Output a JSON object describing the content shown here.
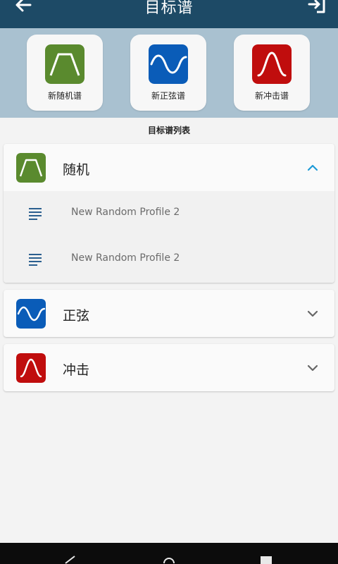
{
  "header": {
    "title": "目标谱",
    "back_icon": "arrow-left-icon",
    "exit_icon": "exit-icon"
  },
  "quick_actions": [
    {
      "label": "新随机谱",
      "icon": "random-profile-icon",
      "color": "#5a8a2e"
    },
    {
      "label": "新正弦谱",
      "icon": "sine-profile-icon",
      "color": "#0a5cb8"
    },
    {
      "label": "新冲击谱",
      "icon": "shock-profile-icon",
      "color": "#c00d0d"
    }
  ],
  "list_title": "目标谱列表",
  "groups": [
    {
      "name": "随机",
      "expanded": true,
      "icon": "random-profile-icon",
      "items": [
        "New Random Profile 2",
        "New Random Profile 2"
      ]
    },
    {
      "name": "正弦",
      "expanded": false,
      "icon": "sine-profile-icon"
    },
    {
      "name": "冲击",
      "expanded": false,
      "icon": "shock-profile-icon"
    }
  ],
  "colors": {
    "header_bg": "#1d4a66",
    "quick_bg": "#a9c1d0",
    "accent": "#1e9bd7",
    "random": "#5a8a2e",
    "sine": "#0a5cb8",
    "shock": "#c00d0d"
  },
  "system_nav": [
    "back-triangle-icon",
    "home-circle-icon",
    "recents-square-icon"
  ]
}
